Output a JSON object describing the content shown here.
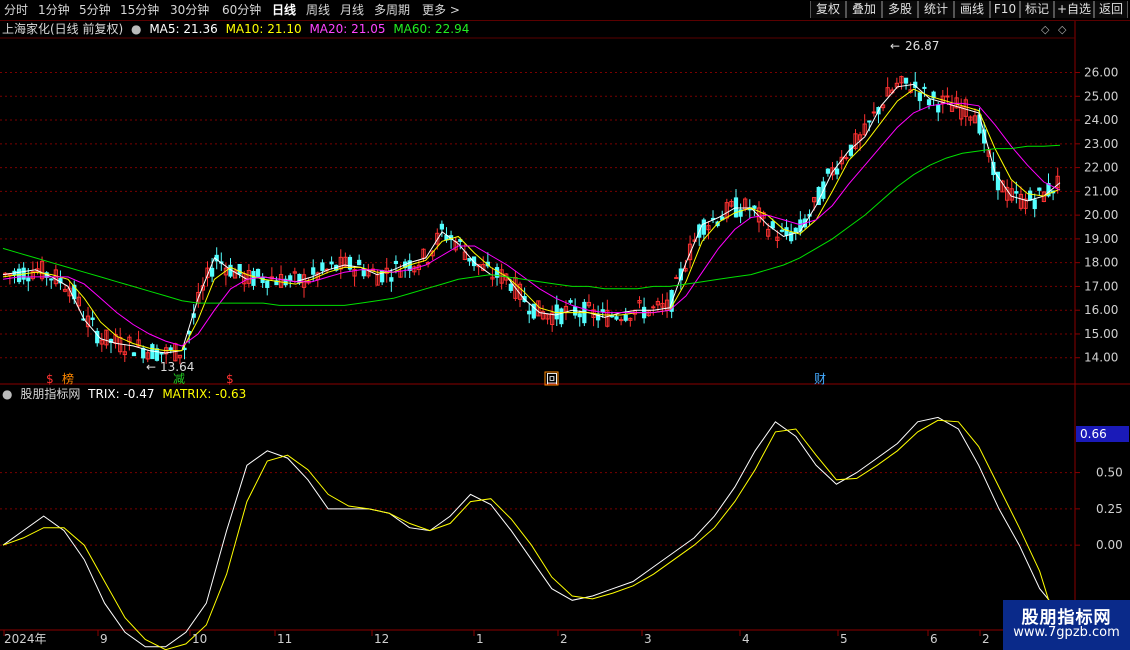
{
  "toolbar": {
    "periods": [
      "分时",
      "1分钟",
      "5分钟",
      "15分钟",
      "30分钟",
      "60分钟",
      "日线",
      "周线",
      "月线",
      "多周期",
      "更多 >"
    ],
    "active_period": "日线",
    "right_buttons": [
      "复权",
      "叠加",
      "多股",
      "统计",
      "画线",
      "F10",
      "标记",
      "+自选",
      "返回"
    ]
  },
  "main_panel": {
    "title": "上海家化(日线 前复权)",
    "ma5": "MA5: 21.36",
    "ma10": "MA10: 21.10",
    "ma20": "MA20: 21.05",
    "ma60": "MA60: 22.94",
    "high_marker": "26.87",
    "low_marker": "13.64",
    "event_markers": [
      "$",
      "榜",
      "减",
      "$",
      "回",
      "财"
    ]
  },
  "sub_panel": {
    "title": "股朋指标网",
    "trix": "TRIX: -0.47",
    "matrix": "MATRIX: -0.63",
    "current_value": "0.66"
  },
  "x_axis_labels": [
    "2024年",
    "9",
    "10",
    "11",
    "12",
    "1",
    "2",
    "3",
    "4",
    "5",
    "6",
    "2"
  ],
  "watermark": {
    "title": "股朋指标网",
    "url": "www.7gpzb.com"
  },
  "colors": {
    "up": "#ff3232",
    "down": "#54ffff",
    "ma5": "#ffffff",
    "ma10": "#ffff00",
    "ma20": "#ff00ff",
    "ma60": "#00e000",
    "trix": "#ffffff",
    "matrix": "#ffff00",
    "grid": "#7a0000"
  },
  "chart_data": [
    {
      "type": "candlestick",
      "title": "上海家化(日线 前复权)",
      "y_ticks": [
        14.0,
        15.0,
        16.0,
        17.0,
        18.0,
        19.0,
        20.0,
        21.0,
        22.0,
        23.0,
        24.0,
        25.0,
        26.0
      ],
      "ylim": [
        13.4,
        27.2
      ],
      "x_labels": [
        "2024年",
        "9",
        "10",
        "11",
        "12",
        "1",
        "2",
        "3",
        "4",
        "5",
        "6"
      ],
      "highest": 26.87,
      "lowest": 13.64,
      "series": [
        {
          "name": "MA5: 21.36",
          "values": [
            17.5,
            17.6,
            17.7,
            17.4,
            17.0,
            15.6,
            14.8,
            14.6,
            14.5,
            14.3,
            14.2,
            14.3,
            16.5,
            18.2,
            17.7,
            17.3,
            17.4,
            17.3,
            17.2,
            17.4,
            17.7,
            17.9,
            17.8,
            17.5,
            17.7,
            18.0,
            18.2,
            19.3,
            18.8,
            18.0,
            17.5,
            17.4,
            16.5,
            15.9,
            15.8,
            16.0,
            15.9,
            15.7,
            15.9,
            16.0,
            16.0,
            16.1,
            18.0,
            19.6,
            19.9,
            20.3,
            20.3,
            19.6,
            19.1,
            19.3,
            20.4,
            21.8,
            22.7,
            23.3,
            24.6,
            25.4,
            25.5,
            24.9,
            24.7,
            24.5,
            24.3,
            21.8,
            20.8,
            20.6,
            20.8,
            21.36
          ]
        },
        {
          "name": "MA10: 21.10",
          "values": [
            17.4,
            17.5,
            17.6,
            17.5,
            17.3,
            16.5,
            15.5,
            14.9,
            14.6,
            14.4,
            14.3,
            14.3,
            15.6,
            17.3,
            17.8,
            17.5,
            17.3,
            17.2,
            17.1,
            17.3,
            17.6,
            17.8,
            17.8,
            17.6,
            17.6,
            17.9,
            18.1,
            18.9,
            19.1,
            18.4,
            17.8,
            17.4,
            16.8,
            16.1,
            15.9,
            15.9,
            15.9,
            15.8,
            15.8,
            15.9,
            15.9,
            16.0,
            17.2,
            18.9,
            19.7,
            20.1,
            20.3,
            20.0,
            19.4,
            19.2,
            19.8,
            21.0,
            22.3,
            23.0,
            23.9,
            24.8,
            25.3,
            25.0,
            24.8,
            24.6,
            24.4,
            22.8,
            21.5,
            20.9,
            20.8,
            21.1
          ]
        },
        {
          "name": "MA20: 21.05",
          "values": [
            17.3,
            17.4,
            17.4,
            17.4,
            17.4,
            17.1,
            16.5,
            15.9,
            15.4,
            15.0,
            14.7,
            14.5,
            15.0,
            16.0,
            16.9,
            17.3,
            17.4,
            17.3,
            17.2,
            17.2,
            17.4,
            17.6,
            17.7,
            17.7,
            17.6,
            17.7,
            17.9,
            18.3,
            18.7,
            18.7,
            18.3,
            17.9,
            17.4,
            16.9,
            16.5,
            16.2,
            16.0,
            15.9,
            15.9,
            15.9,
            15.9,
            16.0,
            16.6,
            17.6,
            18.6,
            19.4,
            19.9,
            20.0,
            19.8,
            19.6,
            19.8,
            20.4,
            21.3,
            22.1,
            22.9,
            23.7,
            24.3,
            24.6,
            24.7,
            24.7,
            24.6,
            23.8,
            22.9,
            22.1,
            21.4,
            21.05
          ]
        },
        {
          "name": "MA60: 22.94",
          "values": [
            18.6,
            18.4,
            18.2,
            18.0,
            17.8,
            17.6,
            17.4,
            17.2,
            17.0,
            16.8,
            16.6,
            16.4,
            16.3,
            16.3,
            16.3,
            16.3,
            16.3,
            16.2,
            16.2,
            16.2,
            16.2,
            16.2,
            16.3,
            16.4,
            16.5,
            16.7,
            16.9,
            17.1,
            17.3,
            17.4,
            17.5,
            17.4,
            17.3,
            17.2,
            17.1,
            17.0,
            17.0,
            16.9,
            16.9,
            16.9,
            17.0,
            17.0,
            17.1,
            17.2,
            17.3,
            17.4,
            17.5,
            17.7,
            17.9,
            18.2,
            18.6,
            19.0,
            19.5,
            20.0,
            20.6,
            21.2,
            21.7,
            22.1,
            22.4,
            22.6,
            22.7,
            22.8,
            22.8,
            22.9,
            22.9,
            22.94
          ]
        }
      ]
    },
    {
      "type": "line",
      "title": "股朋指标网",
      "y_ticks": [
        0.0,
        0.25,
        0.5
      ],
      "ylim": [
        -0.55,
        1.0
      ],
      "series": [
        {
          "name": "TRIX: -0.47",
          "values": [
            0.0,
            0.1,
            0.2,
            0.1,
            -0.1,
            -0.4,
            -0.6,
            -0.7,
            -0.7,
            -0.6,
            -0.4,
            0.1,
            0.55,
            0.65,
            0.6,
            0.45,
            0.25,
            0.25,
            0.25,
            0.22,
            0.12,
            0.1,
            0.2,
            0.35,
            0.28,
            0.1,
            -0.1,
            -0.3,
            -0.38,
            -0.35,
            -0.3,
            -0.25,
            -0.15,
            -0.05,
            0.05,
            0.2,
            0.4,
            0.65,
            0.85,
            0.75,
            0.55,
            0.42,
            0.5,
            0.6,
            0.7,
            0.85,
            0.88,
            0.8,
            0.55,
            0.25,
            0.0,
            -0.3,
            -0.47
          ]
        },
        {
          "name": "MATRIX: -0.63",
          "values": [
            0.0,
            0.05,
            0.12,
            0.12,
            0.0,
            -0.25,
            -0.5,
            -0.65,
            -0.72,
            -0.68,
            -0.55,
            -0.2,
            0.3,
            0.58,
            0.62,
            0.52,
            0.35,
            0.27,
            0.25,
            0.22,
            0.15,
            0.1,
            0.15,
            0.3,
            0.32,
            0.18,
            0.0,
            -0.22,
            -0.35,
            -0.37,
            -0.33,
            -0.28,
            -0.2,
            -0.1,
            0.0,
            0.12,
            0.3,
            0.52,
            0.78,
            0.8,
            0.62,
            0.45,
            0.46,
            0.55,
            0.65,
            0.78,
            0.86,
            0.85,
            0.68,
            0.4,
            0.12,
            -0.18,
            -0.63
          ]
        }
      ]
    }
  ]
}
